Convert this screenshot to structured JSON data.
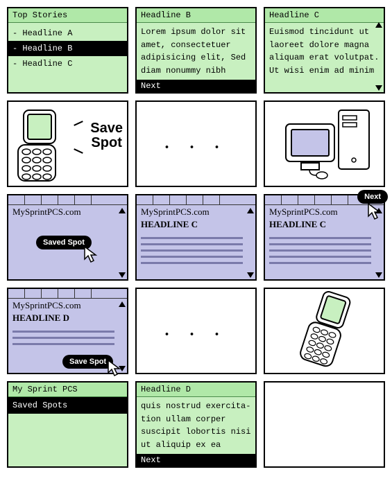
{
  "panels": {
    "p1": {
      "title": "Top Stories",
      "items": [
        "- Headline A",
        "- Headline B",
        "- Headline C"
      ],
      "selected": 1
    },
    "p2": {
      "title": "Headline B",
      "body": "Lorem ipsum dolor sit amet, consectetuer adipisicing elit, Sed diam nonummy nibh",
      "soft": "Next"
    },
    "p3": {
      "title": "Headline C",
      "body": "Euismod tincidunt ut laoreet dolore magna aliquam erat volutpat. Ut wisi enim ad minim"
    },
    "p4": {
      "label_line1": "Save",
      "label_line2": "Spot"
    },
    "p5": {
      "dots": ". . ."
    },
    "p7": {
      "site": "MySprintPCS.com",
      "pill": "Saved Spot"
    },
    "p8": {
      "site": "MySprintPCS.com",
      "headline": "HEADLINE C"
    },
    "p9": {
      "site": "MySprintPCS.com",
      "headline": "HEADLINE C",
      "pill": "Next"
    },
    "p10": {
      "site": "MySprintPCS.com",
      "headline": "HEADLINE D",
      "pill": "Save Spot"
    },
    "p11": {
      "dots": ". . ."
    },
    "p13": {
      "title": "My Sprint PCS",
      "item": "Saved Spots"
    },
    "p14": {
      "title": "Headline D",
      "body": "quis nostrud exercita-tion ullam corper suscipit lobortis nisi ut aliquip ex ea",
      "soft": "Next"
    }
  }
}
